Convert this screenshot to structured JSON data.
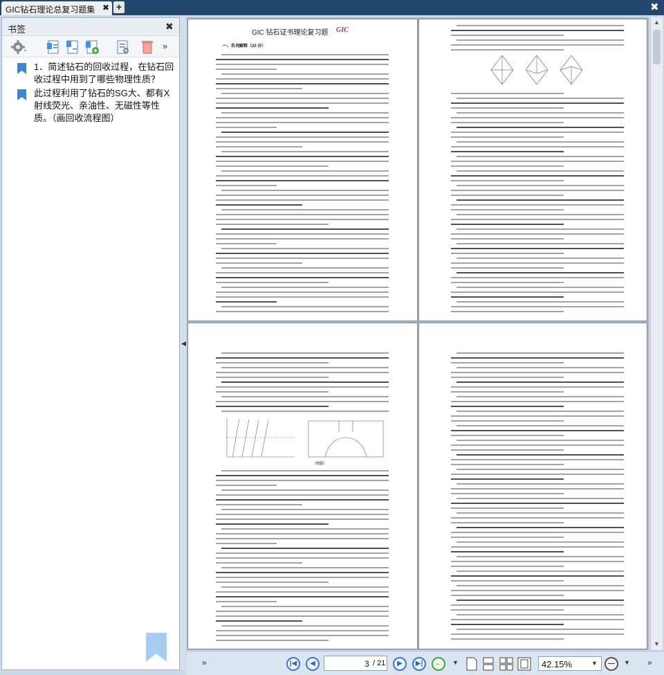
{
  "tab": {
    "title": "GIC钻石理论总复习题集",
    "close": "✖",
    "new": "+"
  },
  "window": {
    "close": "✖"
  },
  "sidebar": {
    "title": "书签",
    "close": "✖",
    "more": "»",
    "items": [
      {
        "text": "1．简述钻石的回收过程，在钻石回收过程中用到了哪些物理性质？"
      },
      {
        "text": "此过程利用了钻石的SG大、都有X射线荧光、亲油性、无磁性等性质。（画回收流程图）"
      }
    ]
  },
  "status": {
    "current_page": "3",
    "total_pages": "/ 21",
    "zoom": "42.15%"
  },
  "doc": {
    "p1": {
      "title": "GIC 钻石证书理论复习题",
      "logo": "GIC",
      "section": "一、名词解释（20 分）"
    },
    "p2": {
      "fig_label": "（附图）"
    }
  },
  "colors": {
    "accent": "#3b78c8",
    "tabbar": "#24476f",
    "bookmark": "#3a86d6"
  },
  "icons": [
    "settings-icon",
    "bookmark-add-icon",
    "bookmark-properties-icon",
    "delete-icon",
    "flag-icon"
  ]
}
